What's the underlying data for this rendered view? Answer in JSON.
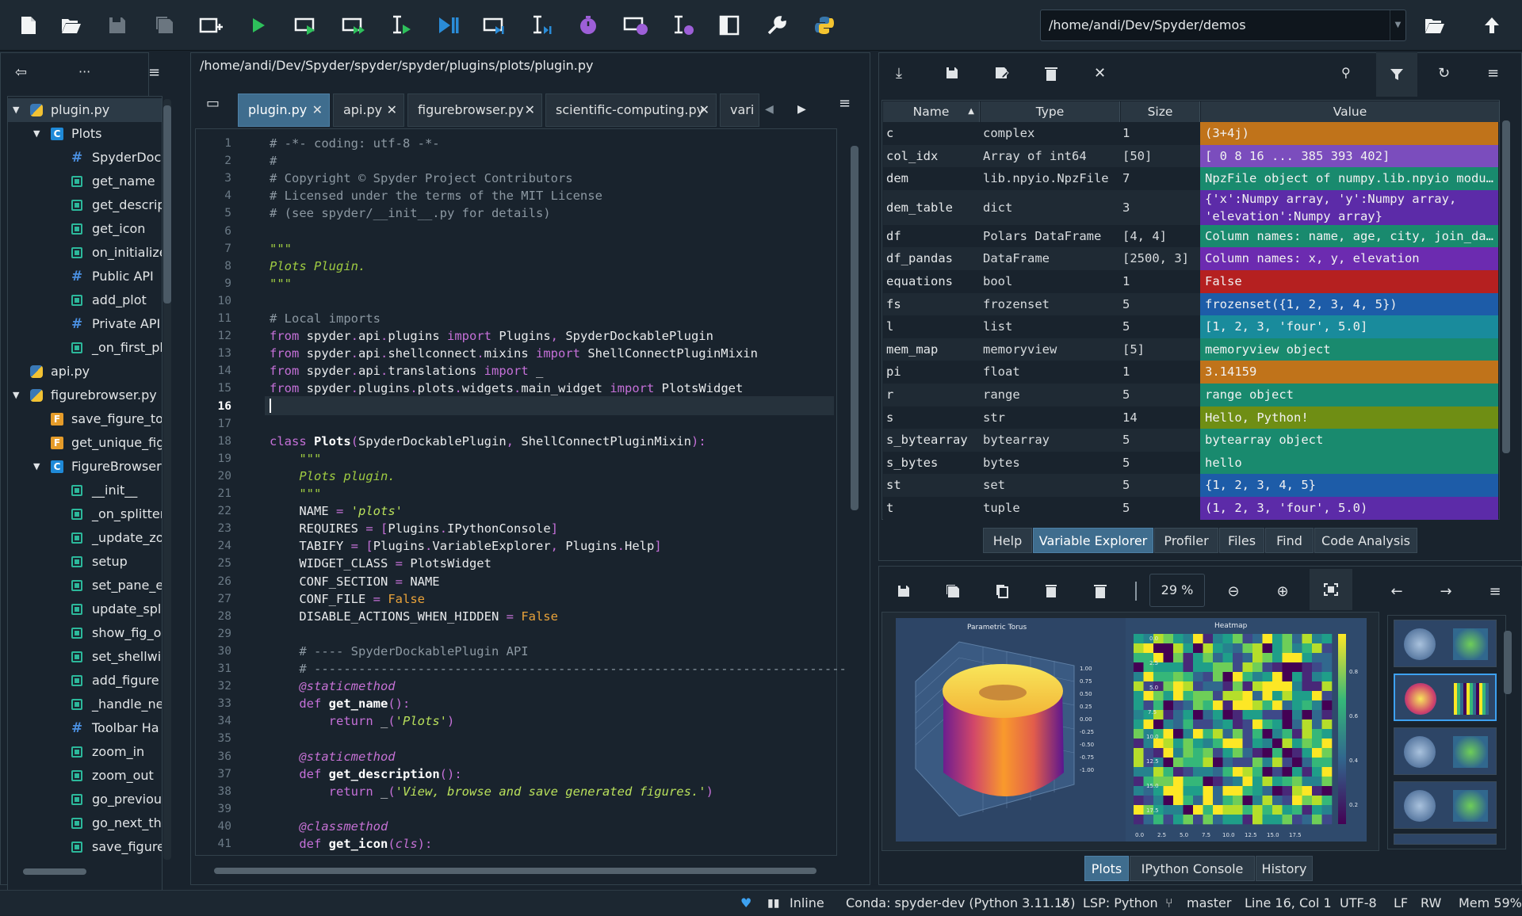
{
  "toolbar": {
    "path": "/home/andi/Dev/Spyder/demos"
  },
  "outline": {
    "items": [
      {
        "label": "plugin.py",
        "kind": "py"
      },
      {
        "label": "Plots",
        "kind": "class"
      },
      {
        "label": "SpyderDocl",
        "kind": "hash"
      },
      {
        "label": "get_name",
        "kind": "fn"
      },
      {
        "label": "get_descrip",
        "kind": "fn"
      },
      {
        "label": "get_icon",
        "kind": "fn"
      },
      {
        "label": "on_initialize",
        "kind": "fn"
      },
      {
        "label": "Public API",
        "kind": "hash"
      },
      {
        "label": "add_plot",
        "kind": "fn"
      },
      {
        "label": "Private API",
        "kind": "hash"
      },
      {
        "label": "_on_first_pl",
        "kind": "fn"
      },
      {
        "label": "api.py",
        "kind": "py"
      },
      {
        "label": "figurebrowser.py",
        "kind": "py"
      },
      {
        "label": "save_figure_to",
        "kind": "F"
      },
      {
        "label": "get_unique_fig",
        "kind": "F"
      },
      {
        "label": "FigureBrowser",
        "kind": "class"
      },
      {
        "label": "__init__",
        "kind": "fn"
      },
      {
        "label": "_on_splitter",
        "kind": "fn"
      },
      {
        "label": "_update_zo",
        "kind": "fn"
      },
      {
        "label": "setup",
        "kind": "fn"
      },
      {
        "label": "set_pane_e",
        "kind": "fn"
      },
      {
        "label": "update_spl",
        "kind": "fn"
      },
      {
        "label": "show_fig_o",
        "kind": "fn"
      },
      {
        "label": "set_shellwi",
        "kind": "fn"
      },
      {
        "label": "add_figure",
        "kind": "fn"
      },
      {
        "label": "_handle_ne",
        "kind": "fn"
      },
      {
        "label": "Toolbar Ha",
        "kind": "hash"
      },
      {
        "label": "zoom_in",
        "kind": "fn"
      },
      {
        "label": "zoom_out",
        "kind": "fn"
      },
      {
        "label": "go_previou",
        "kind": "fn"
      },
      {
        "label": "go_next_th",
        "kind": "fn"
      },
      {
        "label": "save_figure",
        "kind": "fn"
      }
    ]
  },
  "editor": {
    "file_path": "/home/andi/Dev/Spyder/spyder/spyder/plugins/plots/plugin.py",
    "tabs": [
      "plugin.py",
      "api.py",
      "figurebrowser.py",
      "scientific-computing.py",
      "vari"
    ],
    "current_line": 16
  },
  "variables": {
    "headers": {
      "name": "Name",
      "type": "Type",
      "size": "Size",
      "value": "Value"
    },
    "rows": [
      {
        "name": "c",
        "type": "complex",
        "size": "1",
        "value": "(3+4j)",
        "color": "#c0731a"
      },
      {
        "name": "col_idx",
        "type": "Array of int64",
        "size": "[50]",
        "value": "[  0   8  16 ... 385 393 402]",
        "color": "#7b4dbd"
      },
      {
        "name": "dem",
        "type": "lib.npyio.NpzFile",
        "size": "7",
        "value": "NpzFile object of numpy.lib.npyio modu…",
        "color": "#198a6e"
      },
      {
        "name": "dem_table",
        "type": "dict",
        "size": "3",
        "value": "{'x':Numpy array, 'y':Numpy array,",
        "value2": "'elevation':Numpy array}",
        "color": "#5c2ba8"
      },
      {
        "name": "df",
        "type": "Polars DataFrame",
        "size": "[4, 4]",
        "value": "Column names: name, age, city, join_da…",
        "color": "#198a6e"
      },
      {
        "name": "df_pandas",
        "type": "DataFrame",
        "size": "[2500, 3]",
        "value": "Column names: x, y, elevation",
        "color": "#6c2bb0"
      },
      {
        "name": "equations",
        "type": "bool",
        "size": "1",
        "value": "False",
        "color": "#b52020"
      },
      {
        "name": "fs",
        "type": "frozenset",
        "size": "5",
        "value": "frozenset({1, 2, 3, 4, 5})",
        "color": "#1d5ca8"
      },
      {
        "name": "l",
        "type": "list",
        "size": "5",
        "value": "[1, 2, 3, 'four', 5.0]",
        "color": "#198b9c"
      },
      {
        "name": "mem_map",
        "type": "memoryview",
        "size": "[5]",
        "value": "memoryview object",
        "color": "#198a6e"
      },
      {
        "name": "pi",
        "type": "float",
        "size": "1",
        "value": "3.14159",
        "color": "#c0731a"
      },
      {
        "name": "r",
        "type": "range",
        "size": "5",
        "value": "range object",
        "color": "#198a6e"
      },
      {
        "name": "s",
        "type": "str",
        "size": "14",
        "value": "Hello, Python!",
        "color": "#6f8e14"
      },
      {
        "name": "s_bytearray",
        "type": "bytearray",
        "size": "5",
        "value": "bytearray object",
        "color": "#198a6e"
      },
      {
        "name": "s_bytes",
        "type": "bytes",
        "size": "5",
        "value": "hello",
        "color": "#198a6e"
      },
      {
        "name": "st",
        "type": "set",
        "size": "5",
        "value": "{1, 2, 3, 4, 5}",
        "color": "#1d5ca8"
      },
      {
        "name": "t",
        "type": "tuple",
        "size": "5",
        "value": "(1, 2, 3, 'four', 5.0)",
        "color": "#5c2ba8"
      }
    ]
  },
  "top_tabs": [
    "Help",
    "Variable Explorer",
    "Profiler",
    "Files",
    "Find",
    "Code Analysis"
  ],
  "top_tabs_active": "Variable Explorer",
  "plots": {
    "zoom": "29 %",
    "figure_titles": [
      "Parametric Torus",
      "Heatmap"
    ],
    "heatmap_y_ticks": [
      "0.0",
      "2.5",
      "5.0",
      "7.5",
      "10.0",
      "12.5",
      "15.0",
      "17.5"
    ],
    "heatmap_x_ticks": [
      "0.0",
      "2.5",
      "5.0",
      "7.5",
      "10.0",
      "12.5",
      "15.0",
      "17.5"
    ],
    "colorbar_ticks": [
      "0.8",
      "0.6",
      "0.4",
      "0.2"
    ],
    "torus_z_ticks": [
      "1.00",
      "0.75",
      "0.50",
      "0.25",
      "0.00",
      "-0.25",
      "-0.50",
      "-0.75",
      "-1.00"
    ]
  },
  "bottom_tabs": [
    "Plots",
    "IPython Console",
    "History"
  ],
  "bottom_tabs_active": "Plots",
  "status": {
    "inline": "Inline",
    "conda": "Conda: spyder-dev (Python 3.11.15)",
    "lsp": "LSP: Python",
    "branch": "master",
    "position": "Line 16, Col 1",
    "encoding": "UTF-8",
    "eol": "LF",
    "mode": "RW",
    "mem": "Mem 59%"
  }
}
